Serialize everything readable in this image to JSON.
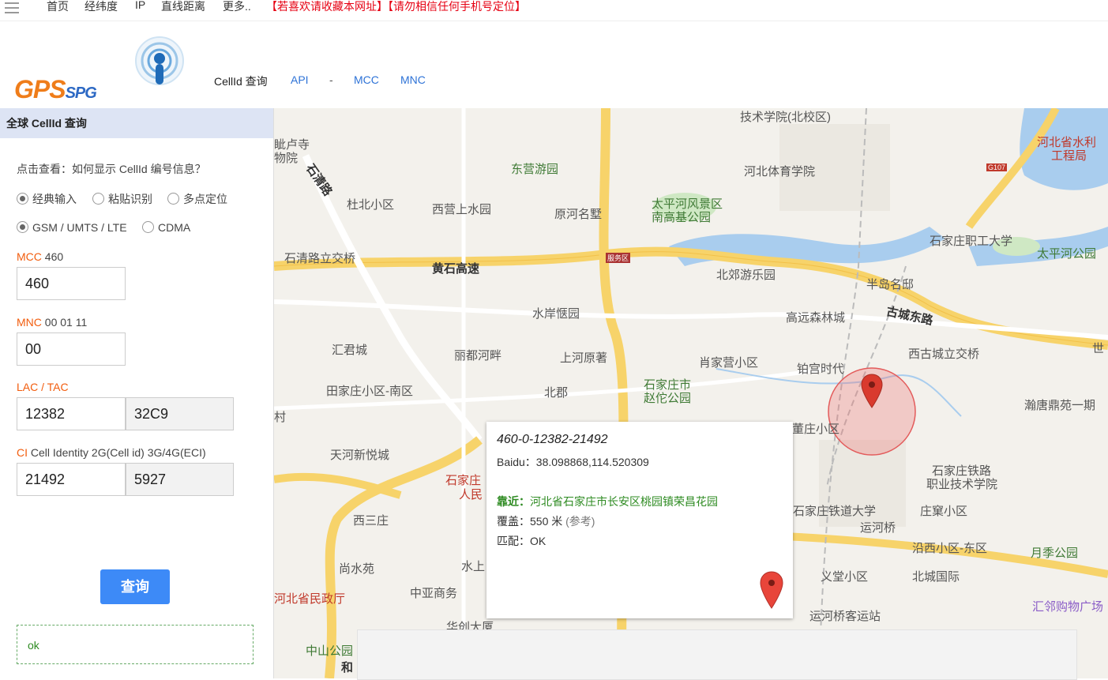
{
  "topnav": {
    "items": [
      "首页",
      "经纬度",
      "IP",
      "直线距离",
      "更多.."
    ],
    "notice": "【若喜欢请收藏本网址】【请勿相信任何手机号定位】"
  },
  "header": {
    "logo_main": "GPS",
    "logo_sub": "SPG",
    "subnav": [
      "CellId 查询",
      "API",
      "-",
      "MCC",
      "MNC"
    ]
  },
  "panel": {
    "title": "全球 CellId 查询",
    "help_link": "点击查看：如何显示 CellId 编号信息？",
    "input_modes": [
      "经典输入",
      "粘贴识别",
      "多点定位"
    ],
    "networks": [
      "GSM / UMTS / LTE",
      "CDMA"
    ],
    "mcc": {
      "label": "MCC",
      "hint": "460",
      "value": "460"
    },
    "mnc": {
      "label": "MNC",
      "hint": "00 01 11",
      "value": "00"
    },
    "lac": {
      "label": "LAC / TAC",
      "value": "12382",
      "hex": "32C9"
    },
    "ci": {
      "label": "CI",
      "hint": "Cell Identity 2G(Cell id) 3G/4G(ECI)",
      "value": "21492",
      "hex": "5927"
    },
    "query_button": "查询",
    "result": "ok"
  },
  "popup": {
    "title": "460-0-12382-21492",
    "baidu": "Baidu：38.098868,114.520309",
    "near_label": "靠近：",
    "near_value": "河北省石家庄市长安区桃园镇荣昌花园",
    "coverage_label": "覆盖：550 米",
    "coverage_ref": "(参考)",
    "match": "匹配：OK"
  },
  "map_labels": [
    "技术学院(北校区)",
    "河北省水利",
    "工程局",
    "东营游园",
    "河北体育学院",
    "石清路",
    "杜北小区",
    "西营上水园",
    "原河名墅",
    "太平河风景区",
    "南高基公园",
    "石家庄职工大学",
    "太平河公园",
    "石清路立交桥",
    "黄石高速",
    "服务区",
    "北郊游乐园",
    "半岛名邸",
    "古城东路",
    "水岸惬园",
    "高远森林城",
    "汇君城",
    "丽都河畔",
    "上河原著",
    "肖家营小区",
    "铂宫时代",
    "西古城立交桥",
    "田家庄小区-南区",
    "北郡",
    "石家庄市",
    "赵佗公园",
    "瀚唐鼎苑一期",
    "天河新悦城",
    "石家庄",
    "人民",
    "西三庄",
    "石家庄铁路",
    "职业技术学院",
    "石家庄铁道大学",
    "庄窠小区",
    "运河桥",
    "尚水苑",
    "沿西小区-东区",
    "月季公园",
    "河北省民政厅",
    "中亚商务",
    "水上",
    "义堂小区",
    "北城国际",
    "汇邻购物广场",
    "中山公园",
    "华创大厦",
    "运河桥客运站",
    "董庄小区",
    "世",
    "眦卢寺",
    "物院",
    "村",
    "和",
    "G107"
  ],
  "colors": {
    "accent": "#3d8af7",
    "warn": "#e60012",
    "orange": "#f25d0e",
    "road": "#f7d36a",
    "water": "#a9cdee"
  }
}
